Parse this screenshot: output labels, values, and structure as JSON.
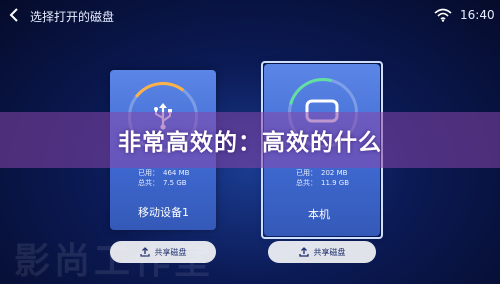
{
  "header": {
    "title": "选择打开的磁盘",
    "time": "16:40"
  },
  "devices": [
    {
      "used_label": "已用：",
      "used_value": "464 MB",
      "total_label": "总共：",
      "total_value": "7.5 GB",
      "name": "移动设备1",
      "icon": "usb-icon",
      "share_label": "共享磁盘"
    },
    {
      "used_label": "已用：",
      "used_value": "202 MB",
      "total_label": "总共：",
      "total_value": "11.9 GB",
      "name": "本机",
      "icon": "local-disk-icon",
      "share_label": "共享磁盘"
    }
  ],
  "banner": {
    "text": "非常高效的：高效的什么"
  },
  "watermark": {
    "text": "影尚工作室"
  },
  "colors": {
    "card": "#4a74da",
    "selected_border": "#cfe0ff",
    "usage_arc_1": "#ffb347",
    "usage_arc_2": "#62e0a0",
    "banner": "#8746aa"
  }
}
